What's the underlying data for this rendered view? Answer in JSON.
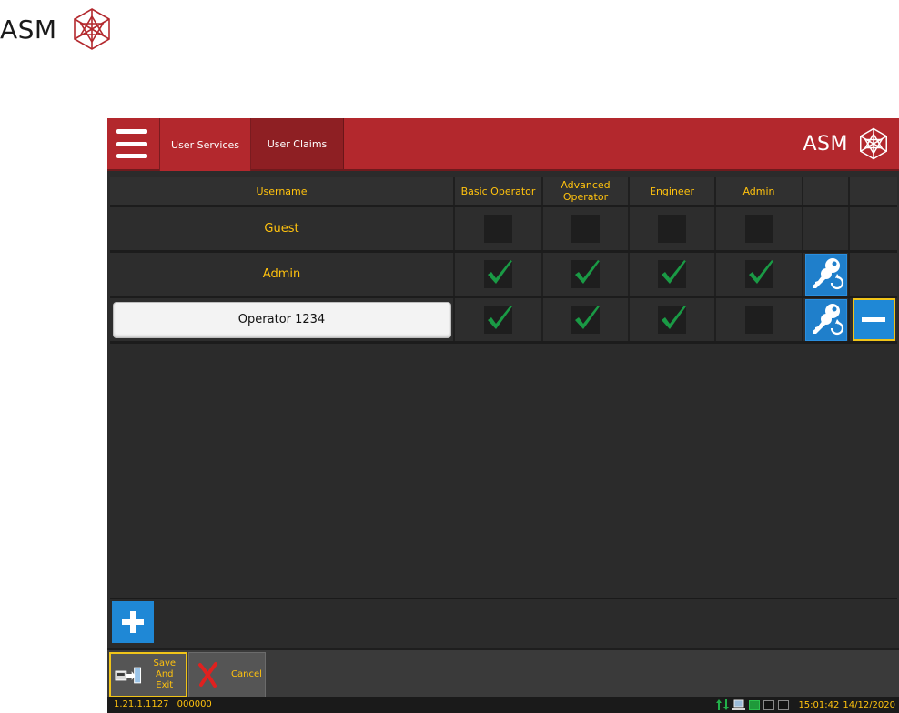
{
  "page_logo": {
    "text": "ASM"
  },
  "titlebar": {
    "tabs": [
      {
        "label": "User Services"
      },
      {
        "label": "User Claims"
      }
    ],
    "logo_text": "ASM"
  },
  "table": {
    "headers": {
      "username": "Username",
      "basic": "Basic Operator",
      "advanced": "Advanced\nOperator",
      "engineer": "Engineer",
      "admin": "Admin"
    },
    "rows": [
      {
        "username": "Guest",
        "basic": false,
        "advanced": false,
        "engineer": false,
        "admin": false,
        "editable": false,
        "has_key": false,
        "has_delete": false
      },
      {
        "username": "Admin",
        "basic": true,
        "advanced": true,
        "engineer": true,
        "admin": true,
        "editable": false,
        "has_key": true,
        "has_delete": false
      },
      {
        "username": "Operator 1234",
        "basic": true,
        "advanced": true,
        "engineer": true,
        "admin": false,
        "editable": true,
        "has_key": true,
        "has_delete": true
      }
    ]
  },
  "toolbar": {
    "save_label": "Save And\nExit",
    "cancel_label": "Cancel"
  },
  "status": {
    "version": "1.21.1.1127",
    "code": "000000",
    "time": "15:01:42",
    "date": "14/12/2020"
  },
  "colors": {
    "accent_red": "#b3282d",
    "label_yellow": "#ffc20e",
    "check_green": "#1a9a45",
    "button_blue": "#1f88d6"
  }
}
